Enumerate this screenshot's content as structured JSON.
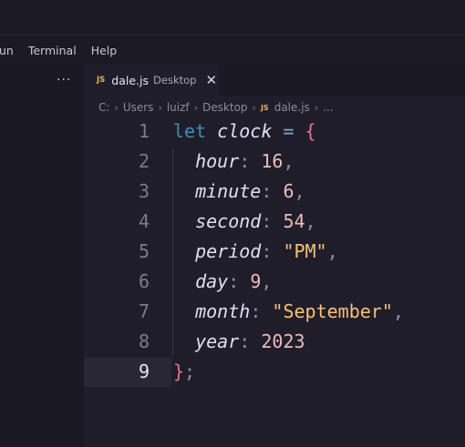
{
  "menubar": {
    "items": [
      "un",
      "Terminal",
      "Help"
    ]
  },
  "sidebar": {
    "more_label": "..."
  },
  "tab": {
    "icon_label": "JS",
    "name": "dale.js",
    "description": "Desktop",
    "close_label": "✕"
  },
  "breadcrumb": {
    "segments": [
      "C:",
      "Users",
      "luizf",
      "Desktop"
    ],
    "file_icon_label": "JS",
    "file": "dale.js",
    "trailing": "...",
    "separator": "›"
  },
  "editor": {
    "active_line": 9,
    "lines": [
      {
        "number": "1",
        "tokens": [
          [
            "kw",
            "let"
          ],
          [
            "plain",
            " "
          ],
          [
            "var",
            "clock"
          ],
          [
            "plain",
            " "
          ],
          [
            "op",
            "="
          ],
          [
            "plain",
            " "
          ],
          [
            "brace",
            "{"
          ]
        ]
      },
      {
        "number": "2",
        "tokens": [
          [
            "plain",
            "  "
          ],
          [
            "prop",
            "hour"
          ],
          [
            "punc",
            ":"
          ],
          [
            "plain",
            " "
          ],
          [
            "num",
            "16"
          ],
          [
            "punc",
            ","
          ]
        ]
      },
      {
        "number": "3",
        "tokens": [
          [
            "plain",
            "  "
          ],
          [
            "prop",
            "minute"
          ],
          [
            "punc",
            ":"
          ],
          [
            "plain",
            " "
          ],
          [
            "num",
            "6"
          ],
          [
            "punc",
            ","
          ]
        ]
      },
      {
        "number": "4",
        "tokens": [
          [
            "plain",
            "  "
          ],
          [
            "prop",
            "second"
          ],
          [
            "punc",
            ":"
          ],
          [
            "plain",
            " "
          ],
          [
            "num",
            "54"
          ],
          [
            "punc",
            ","
          ]
        ]
      },
      {
        "number": "5",
        "tokens": [
          [
            "plain",
            "  "
          ],
          [
            "prop",
            "period"
          ],
          [
            "punc",
            ":"
          ],
          [
            "plain",
            " "
          ],
          [
            "str",
            "\"PM\""
          ],
          [
            "punc",
            ","
          ]
        ]
      },
      {
        "number": "6",
        "tokens": [
          [
            "plain",
            "  "
          ],
          [
            "prop",
            "day"
          ],
          [
            "punc",
            ":"
          ],
          [
            "plain",
            " "
          ],
          [
            "num",
            "9"
          ],
          [
            "punc",
            ","
          ]
        ]
      },
      {
        "number": "7",
        "tokens": [
          [
            "plain",
            "  "
          ],
          [
            "prop",
            "month"
          ],
          [
            "punc",
            ":"
          ],
          [
            "plain",
            " "
          ],
          [
            "str",
            "\"September\""
          ],
          [
            "punc",
            ","
          ]
        ]
      },
      {
        "number": "8",
        "tokens": [
          [
            "plain",
            "  "
          ],
          [
            "prop",
            "year"
          ],
          [
            "punc",
            ":"
          ],
          [
            "plain",
            " "
          ],
          [
            "num",
            "2023"
          ]
        ]
      },
      {
        "number": "9",
        "tokens": [
          [
            "brace",
            "}"
          ],
          [
            "punc",
            ";"
          ]
        ]
      }
    ]
  },
  "colors": {
    "background": "#1c1a25",
    "editor_background": "#1f1d29",
    "keyword": "#3e8fb0",
    "string": "#f6c177",
    "number": "#ebbcba",
    "brace": "#eb6f92",
    "js_icon": "#e5b64a"
  }
}
